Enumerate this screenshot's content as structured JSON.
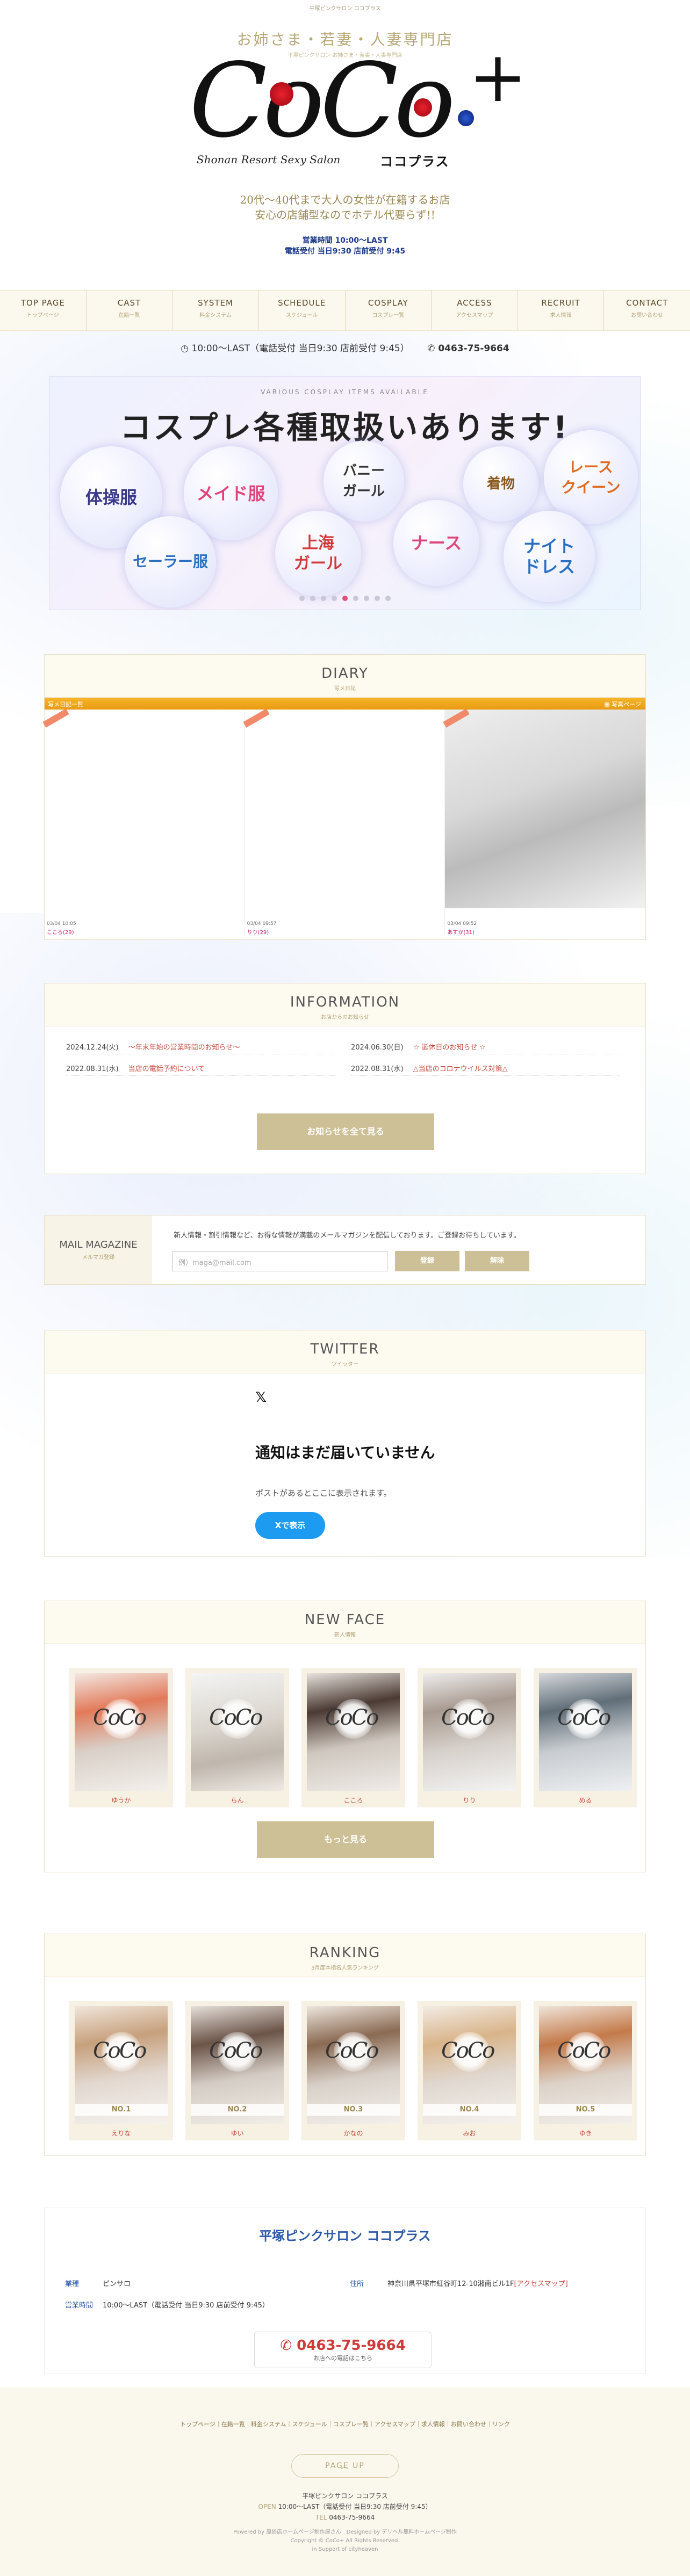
{
  "top_line": "平塚ピンクサロン ココプラス",
  "header": {
    "tagline": "お姉さま・若妻・人妻専門店",
    "tagline_sub": "平塚ピンクサロン お姉さま・若妻・人妻専門店",
    "logo_text": "CoCo",
    "logo_sub": "Shonan Resort Sexy Salon",
    "logo_kana": "ココプラス",
    "desc1": "20代～40代まで大人の女性が在籍するお店",
    "desc2": "安心の店舗型なのでホテル代要らず!!",
    "hours1": "営業時間 10:00～LAST",
    "hours2": "電話受付 当日9:30 店前受付 9:45"
  },
  "nav": [
    {
      "en": "TOP PAGE",
      "jp": "トップページ"
    },
    {
      "en": "CAST",
      "jp": "在籍一覧"
    },
    {
      "en": "SYSTEM",
      "jp": "料金システム"
    },
    {
      "en": "SCHEDULE",
      "jp": "スケジュール"
    },
    {
      "en": "COSPLAY",
      "jp": "コスプレ一覧"
    },
    {
      "en": "ACCESS",
      "jp": "アクセスマップ"
    },
    {
      "en": "RECRUIT",
      "jp": "求人情報"
    },
    {
      "en": "CONTACT",
      "jp": "お問い合わせ"
    }
  ],
  "tel_strip": {
    "hours": "10:00～LAST（電話受付 当日9:30 店前受付 9:45）",
    "tel": "0463-75-9664"
  },
  "banner": {
    "small": "VARIOUS COSPLAY ITEMS AVAILABLE",
    "title": "コスプレ各種取扱いあります!",
    "items": [
      "体操服",
      "メイド服",
      "バニー\nガール",
      "着物",
      "レース\nクイーン",
      "セーラー服",
      "上海\nガール",
      "ナース",
      "ナイト\nドレス"
    ]
  },
  "diary": {
    "en": "DIARY",
    "jp": "写メ日記",
    "bar_left": "写メ日記一覧",
    "bar_right": "写真ページ",
    "posts": [
      {
        "meta": "03/04 10:05",
        "name": "こころ(29)"
      },
      {
        "meta": "03/04 09:57",
        "name": "りり(29)"
      },
      {
        "meta": "03/04 09:52",
        "name": "あすか(31)"
      }
    ]
  },
  "information": {
    "en": "INFORMATION",
    "jp": "お店からのお知らせ",
    "items": [
      {
        "date": "2024.12.24(火)",
        "text": "～年末年始の営業時間のお知らせ～"
      },
      {
        "date": "2024.06.30(日)",
        "text": "☆ 誕休日のお知らせ ☆"
      },
      {
        "date": "2022.08.31(水)",
        "text": "当店の電話予約について"
      },
      {
        "date": "2022.08.31(水)",
        "text": "△当店のコロナウイルス対策△"
      }
    ],
    "button": "お知らせを全て見る"
  },
  "mail": {
    "en": "MAIL MAGAZINE",
    "jp": "メルマガ登録",
    "text": "新人情報・割引情報など、お得な情報が満載のメールマガジンを配信しております。ご登録お待ちしています。",
    "placeholder": "例）maga@mail.com",
    "btn_register": "登録",
    "btn_cancel": "解除"
  },
  "twitter": {
    "en": "TWITTER",
    "jp": "ツイッター",
    "x": "𝕏",
    "message": "通知はまだ届いていません",
    "sub": "ポストがあるとここに表示されます。",
    "button": "Xで表示"
  },
  "newface": {
    "en": "NEW FACE",
    "jp": "新人情報",
    "names": [
      "ゆうか",
      "らん",
      "こころ",
      "りり",
      "める"
    ],
    "button": "もっと見る"
  },
  "ranking": {
    "en": "RANKING",
    "jp": "3月度本指名人気ランキング",
    "items": [
      {
        "rank": "NO.1",
        "name": "えりな"
      },
      {
        "rank": "NO.2",
        "name": "ゆい"
      },
      {
        "rank": "NO.3",
        "name": "かなの"
      },
      {
        "rank": "NO.4",
        "name": "みお"
      },
      {
        "rank": "NO.5",
        "name": "ゆき"
      }
    ]
  },
  "logo_watermark": "CoCo",
  "shop": {
    "title": "平塚ピンクサロン ココプラス",
    "type_k": "業種",
    "type_v": "ピンサロ",
    "addr_k": "住所",
    "addr_v": "神奈川県平塚市紅谷町12-10湘南ビル1F",
    "addr_link": "[アクセスマップ]",
    "hours_k": "営業時間",
    "hours_v": "10:00～LAST（電話受付 当日9:30 店前受付 9:45）",
    "tel": "0463-75-9664",
    "tel_sub": "お店への電話はこちら"
  },
  "footer": {
    "links": "トップページ｜在籍一覧｜料金システム｜スケジュール｜コスプレ一覧｜アクセスマップ｜求人情報｜お問い合わせ｜リンク",
    "pageup": "PAGE UP",
    "name": "平塚ピンクサロン ココプラス",
    "open_k": "OPEN",
    "open_v": "10:00～LAST（電話受付 当日9:30 店前受付 9:45）",
    "tel_k": "TEL",
    "tel_v": "0463-75-9664",
    "powered": "Powered by 風俗店ホームページ制作屋さん　Designed by デリヘル無料ホームページ制作",
    "copyright": "Copyright © CoCo+ All Rights Reserved.",
    "support": "in Support of cityheaven"
  }
}
